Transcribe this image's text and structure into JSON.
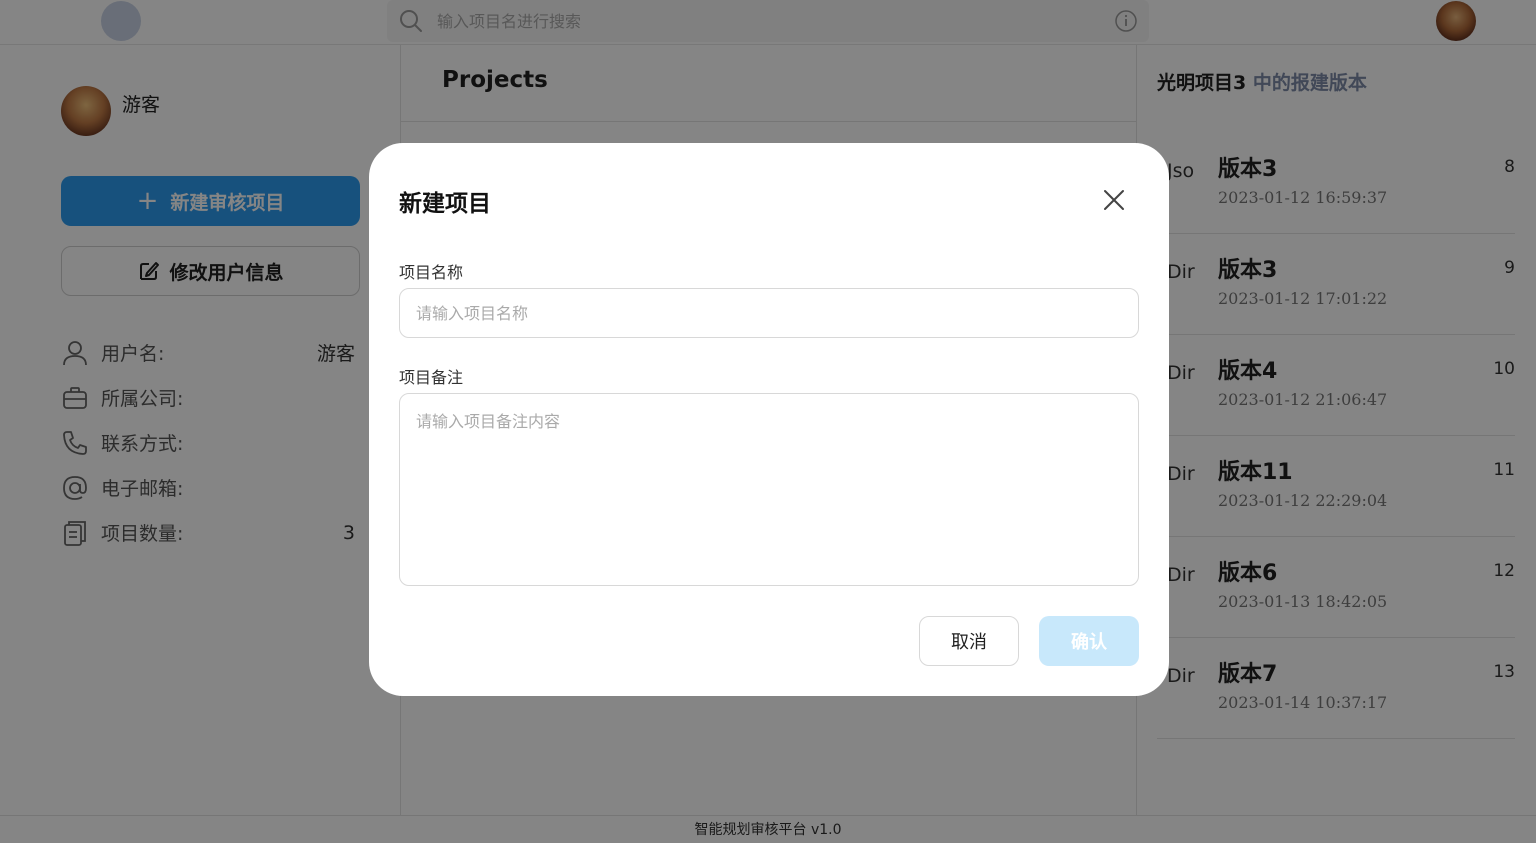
{
  "topbar": {
    "search_placeholder": "输入项目名进行搜索",
    "icons": [
      "logo-icon",
      "search-icon",
      "info-icon",
      "avatar"
    ]
  },
  "sidebar": {
    "user_name": "游客",
    "new_project_label": "新建审核项目",
    "edit_user_label": "修改用户信息",
    "info": [
      {
        "icon": "user-icon",
        "label": "用户名:",
        "value": "游客"
      },
      {
        "icon": "briefcase-icon",
        "label": "所属公司:",
        "value": ""
      },
      {
        "icon": "phone-icon",
        "label": "联系方式:",
        "value": ""
      },
      {
        "icon": "at-icon",
        "label": "电子邮箱:",
        "value": ""
      },
      {
        "icon": "clipboard-icon",
        "label": "项目数量:",
        "value": "3"
      }
    ]
  },
  "main": {
    "title": "Projects"
  },
  "versions": {
    "title_project": "光明项目3",
    "title_suffix": " 中的报建版本",
    "items": [
      {
        "type": "Jso",
        "name": "版本3",
        "time": "2023-01-12 16:59:37",
        "num": "8"
      },
      {
        "type": "Dir",
        "name": "版本3",
        "time": "2023-01-12 17:01:22",
        "num": "9"
      },
      {
        "type": "Dir",
        "name": "版本4",
        "time": "2023-01-12 21:06:47",
        "num": "10"
      },
      {
        "type": "Dir",
        "name": "版本11",
        "time": "2023-01-12 22:29:04",
        "num": "11"
      },
      {
        "type": "Dir",
        "name": "版本6",
        "time": "2023-01-13 18:42:05",
        "num": "12"
      },
      {
        "type": "Dir",
        "name": "版本7",
        "time": "2023-01-14 10:37:17",
        "num": "13"
      }
    ]
  },
  "footer": {
    "text": "智能规划审核平台 v1.0"
  },
  "modal": {
    "title": "新建项目",
    "name_label": "项目名称",
    "name_placeholder": "请输入项目名称",
    "name_value": "",
    "note_label": "项目备注",
    "note_placeholder": "请输入项目备注内容",
    "note_value": "",
    "cancel_label": "取消",
    "confirm_label": "确认"
  },
  "colors": {
    "primary": "#2d9cf0",
    "primary_disabled": "#c8e8fb",
    "overlay": "rgba(0,0,0,0.48)",
    "version_subtitle": "#7d8aa8"
  }
}
